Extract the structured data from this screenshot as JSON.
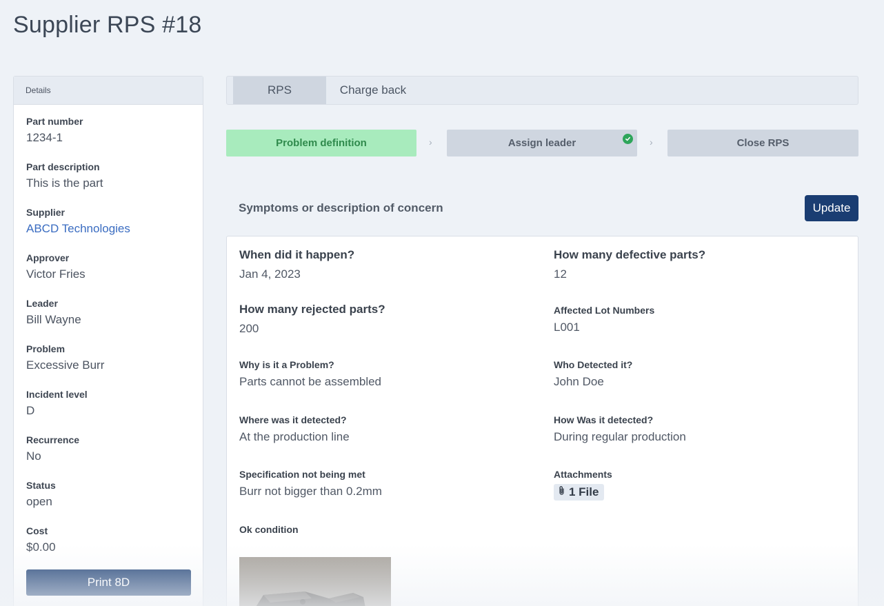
{
  "page": {
    "title": "Supplier RPS #18"
  },
  "sidebar": {
    "header": "Details",
    "fields": [
      {
        "label": "Part number",
        "value": "1234-1"
      },
      {
        "label": "Part description",
        "value": "This is the part"
      },
      {
        "label": "Supplier",
        "value": "ABCD Technologies"
      },
      {
        "label": "Approver",
        "value": "Victor Fries"
      },
      {
        "label": "Leader",
        "value": "Bill Wayne"
      },
      {
        "label": "Problem",
        "value": "Excessive Burr"
      },
      {
        "label": "Incident level",
        "value": "D"
      },
      {
        "label": "Recurrence",
        "value": "No"
      },
      {
        "label": "Status",
        "value": "open"
      },
      {
        "label": "Cost",
        "value": "$0.00"
      }
    ],
    "print_button": "Print 8D"
  },
  "tabs": [
    {
      "label": "RPS",
      "active": true
    },
    {
      "label": "Charge back",
      "active": false
    }
  ],
  "steps": [
    {
      "label": "Problem definition",
      "state": "active"
    },
    {
      "label": "Assign leader",
      "state": "complete"
    },
    {
      "label": "Close RPS",
      "state": "pending"
    }
  ],
  "section": {
    "title": "Symptoms or description of concern",
    "update_button": "Update"
  },
  "details": {
    "when": {
      "label": "When did it happen?",
      "value": "Jan 4, 2023"
    },
    "defective": {
      "label": "How many defective parts?",
      "value": "12"
    },
    "rejected": {
      "label": "How many rejected parts?",
      "value": "200"
    },
    "lots": {
      "label": "Affected Lot Numbers",
      "value": "L001"
    },
    "why": {
      "label": "Why is it a Problem?",
      "value": "Parts cannot be assembled"
    },
    "who": {
      "label": "Who Detected it?",
      "value": "John Doe"
    },
    "where": {
      "label": "Where was it detected?",
      "value": "At the production line"
    },
    "how": {
      "label": "How Was it detected?",
      "value": "During regular production"
    },
    "spec": {
      "label": "Specification not being met",
      "value": "Burr not bigger than 0.2mm"
    },
    "attachments": {
      "label": "Attachments",
      "value": "1 File"
    },
    "ok_condition": {
      "label": "Ok condition"
    }
  },
  "colors": {
    "primary": "#1a3d72",
    "success_bg": "#a8ebbd",
    "success_text": "#2f8a4c",
    "link": "#3a6cc1"
  },
  "icons": [
    "check-circle-icon",
    "paperclip-icon",
    "chevron-right-icon"
  ]
}
